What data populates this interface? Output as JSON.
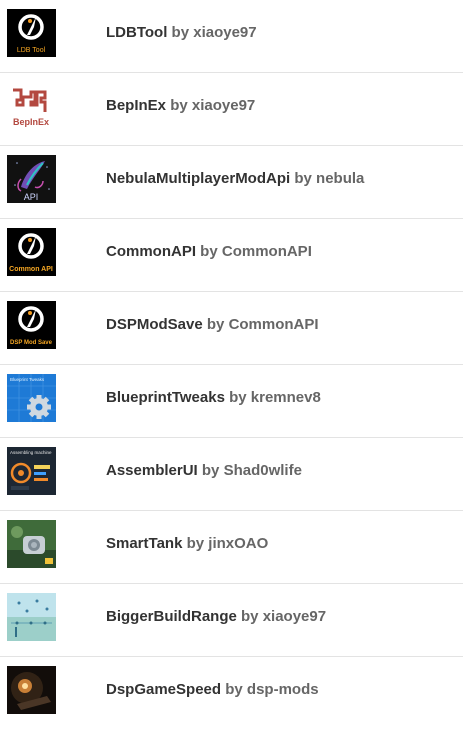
{
  "mods": [
    {
      "name": "LDBTool",
      "author": "xiaoye97",
      "by": "by",
      "icon": "ldbtool-icon",
      "icon_text": "LDB Tool"
    },
    {
      "name": "BepInEx",
      "author": "xiaoye97",
      "by": "by",
      "icon": "bepinex-icon",
      "icon_text": "BepInEx"
    },
    {
      "name": "NebulaMultiplayerModApi",
      "author": "nebula",
      "by": "by",
      "icon": "nebula-api-icon",
      "icon_text": "API"
    },
    {
      "name": "CommonAPI",
      "author": "CommonAPI",
      "by": "by",
      "icon": "commonapi-icon",
      "icon_text": "Common API"
    },
    {
      "name": "DSPModSave",
      "author": "CommonAPI",
      "by": "by",
      "icon": "dspmodsave-icon",
      "icon_text": "DSP Mod Save"
    },
    {
      "name": "BlueprintTweaks",
      "author": "kremnev8",
      "by": "by",
      "icon": "blueprint-gear-icon",
      "icon_text": "Blueprint Tweaks"
    },
    {
      "name": "AssemblerUI",
      "author": "Shad0wlife",
      "by": "by",
      "icon": "assembler-screenshot-icon",
      "icon_text": "Assembling machine"
    },
    {
      "name": "SmartTank",
      "author": "jinxOAO",
      "by": "by",
      "icon": "smarttank-screenshot-icon",
      "icon_text": ""
    },
    {
      "name": "BiggerBuildRange",
      "author": "xiaoye97",
      "by": "by",
      "icon": "buildrange-screenshot-icon",
      "icon_text": ""
    },
    {
      "name": "DspGameSpeed",
      "author": "dsp-mods",
      "by": "by",
      "icon": "gamespeed-screenshot-icon",
      "icon_text": ""
    }
  ]
}
